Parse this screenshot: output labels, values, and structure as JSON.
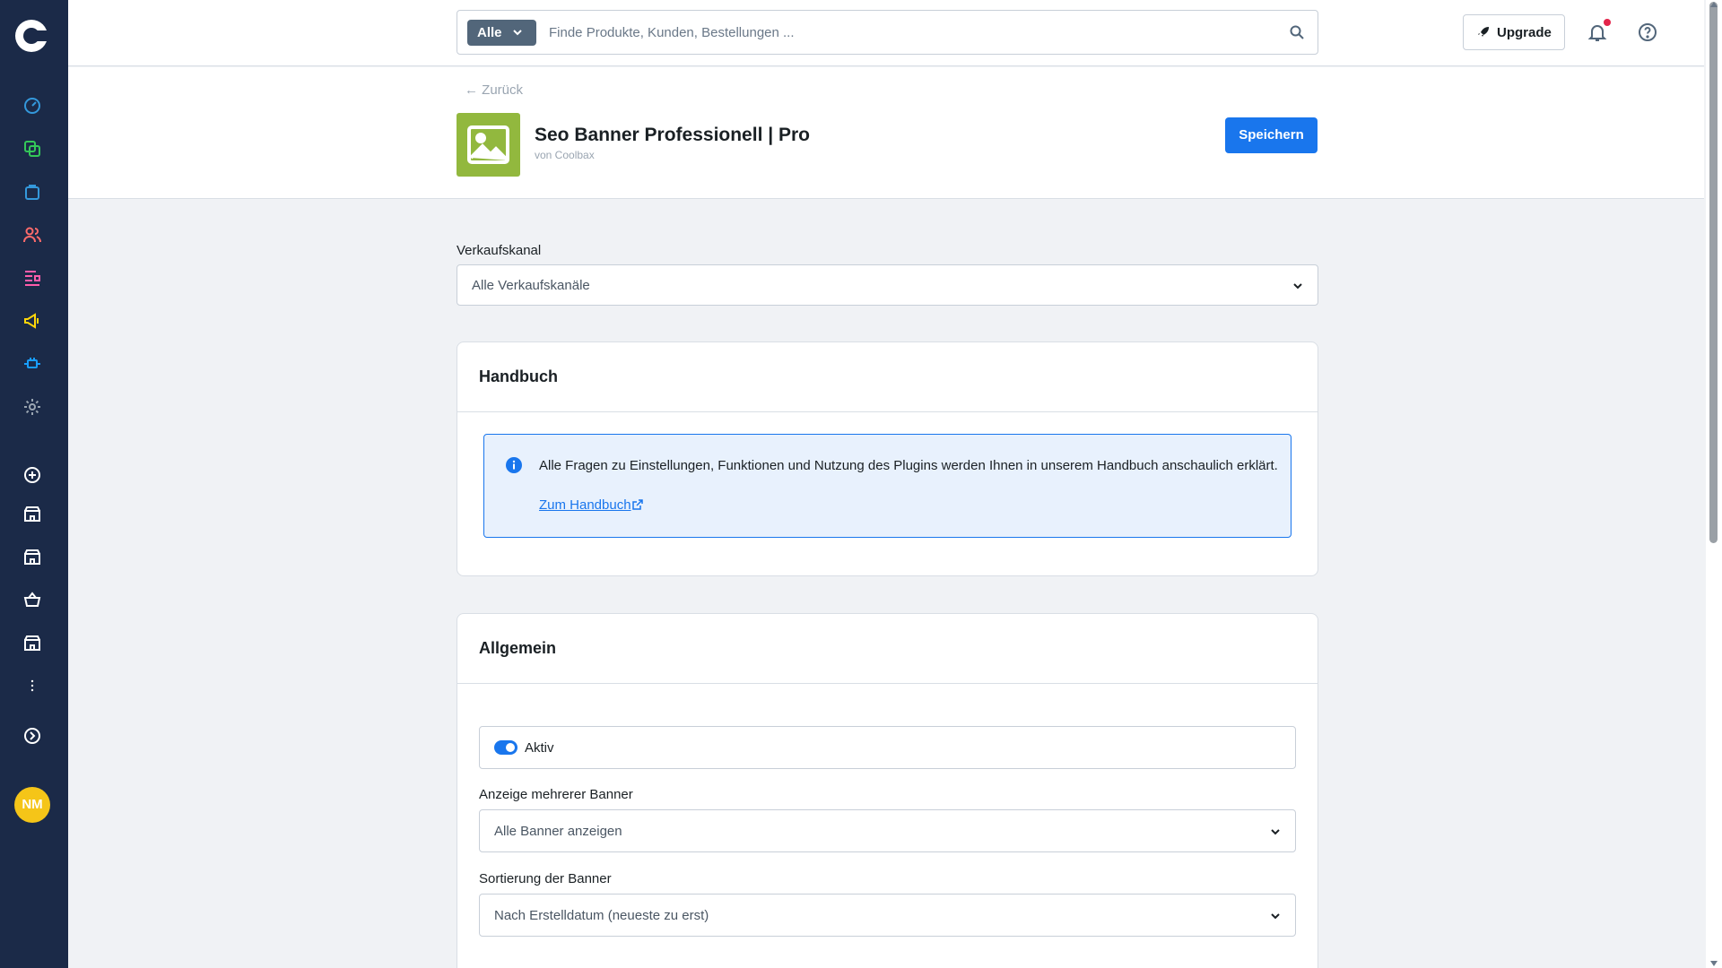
{
  "sidebar": {
    "logo": "shopware-logo",
    "items": [
      {
        "icon": "dashboard-icon",
        "color": "#3498db"
      },
      {
        "icon": "catalogue-icon",
        "color": "#34c759"
      },
      {
        "icon": "orders-icon",
        "color": "#3498db"
      },
      {
        "icon": "customers-icon",
        "color": "#ff6b6b"
      },
      {
        "icon": "content-icon",
        "color": "#ff5dab"
      },
      {
        "icon": "marketing-icon",
        "color": "#ffd60a"
      },
      {
        "icon": "extensions-icon",
        "color": "#189eff"
      },
      {
        "icon": "settings-icon",
        "color": "#9aa5b1"
      },
      {
        "icon": "add-sales-channel-icon",
        "color": "#ffffff"
      },
      {
        "icon": "storefront-icon",
        "color": "#ffffff"
      },
      {
        "icon": "storefront-icon",
        "color": "#ffffff"
      },
      {
        "icon": "basket-icon",
        "color": "#ffffff"
      },
      {
        "icon": "storefront-icon",
        "color": "#ffffff"
      },
      {
        "icon": "more-icon",
        "color": "#ffffff"
      },
      {
        "icon": "collapse-icon",
        "color": "#ffffff"
      }
    ],
    "avatar_initials": "NM"
  },
  "topbar": {
    "search_type": "Alle",
    "search_placeholder": "Finde Produkte, Kunden, Bestellungen ...",
    "upgrade_label": "Upgrade"
  },
  "header": {
    "back_label": "← Zurück",
    "app_title": "Seo Banner Professionell | Pro",
    "app_vendor": "von Coolbax",
    "save_label": "Speichern"
  },
  "sales_channel": {
    "label": "Verkaufskanal",
    "value": "Alle Verkaufskanäle"
  },
  "manual_card": {
    "title": "Handbuch",
    "info_text": "Alle Fragen zu Einstellungen, Funktionen und Nutzung des Plugins werden Ihnen in unserem Handbuch anschaulich erklärt.",
    "link_label": "Zum Handbuch"
  },
  "general_card": {
    "title": "Allgemein",
    "active_label": "Aktiv",
    "active_on": true,
    "multi_banner_label": "Anzeige mehrerer Banner",
    "multi_banner_value": "Alle Banner anzeigen",
    "sort_label": "Sortierung der Banner",
    "sort_value": "Nach Erstelldatum (neueste zu erst)"
  },
  "colors": {
    "primary": "#1976ed",
    "sidebar_bg": "#1b2a48",
    "app_thumb": "#92b83e",
    "avatar": "#f5c518"
  }
}
